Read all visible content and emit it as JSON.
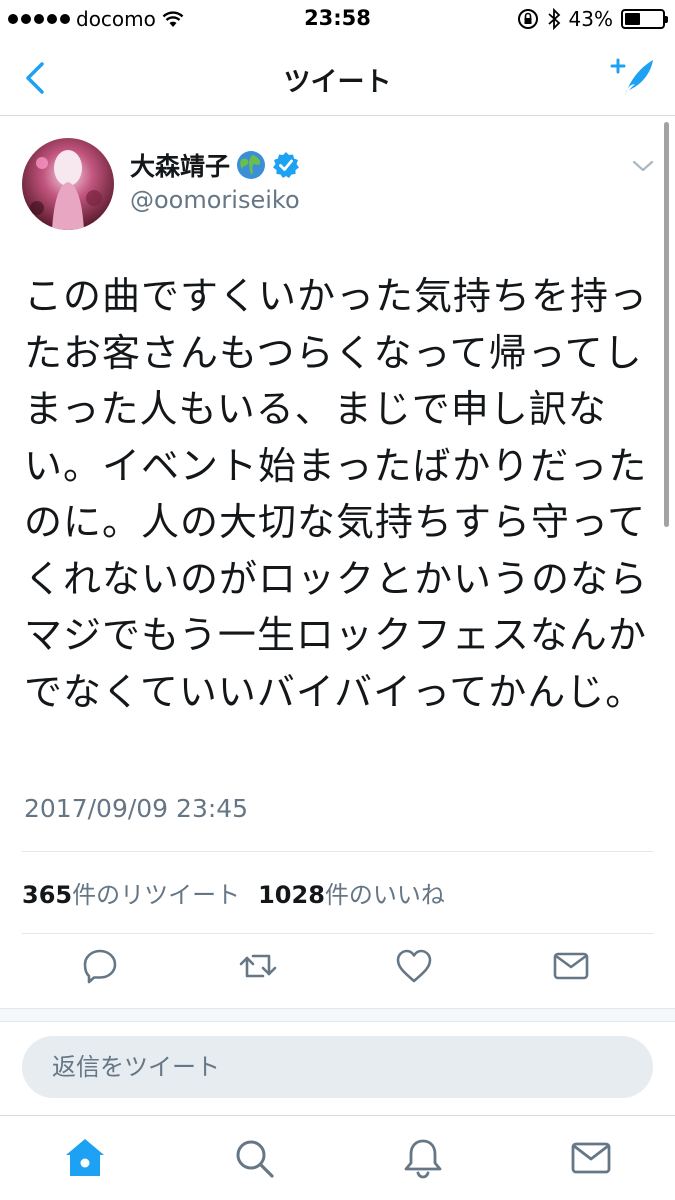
{
  "status_bar": {
    "carrier": "docomo",
    "time": "23:58",
    "battery": "43%",
    "battery_level": 0.43
  },
  "nav": {
    "title": "ツイート"
  },
  "tweet": {
    "display_name": "大森靖子",
    "handle": "@oomoriseiko",
    "text": "この曲ですくいかった気持ちを持ったお客さんもつらくなって帰ってしまった人もいる、まじで申し訳ない。イベント始まったばかりだったのに。人の大切な気持ちすら守ってくれないのがロックとかいうのならマジでもう一生ロックフェスなんかでなくていいバイバイってかんじ。",
    "timestamp": "2017/09/09 23:45",
    "retweet_count": "365",
    "retweet_label": "件のリツイート",
    "like_count": "1028",
    "like_label": "件のいいね"
  },
  "reply": {
    "placeholder": "返信をツイート"
  },
  "colors": {
    "accent": "#1da1f2",
    "icon_gray": "#657786",
    "text": "#14171a"
  },
  "icons": {
    "nav": [
      "back-chevron-icon",
      "compose-tweet-icon"
    ],
    "tweet": [
      "globe-emoji-icon",
      "verified-badge-icon",
      "caret-down-icon"
    ],
    "actions": [
      "reply-icon",
      "retweet-icon",
      "like-icon",
      "direct-message-icon"
    ],
    "tabs": [
      "home-icon",
      "search-icon",
      "notifications-icon",
      "messages-icon"
    ]
  }
}
